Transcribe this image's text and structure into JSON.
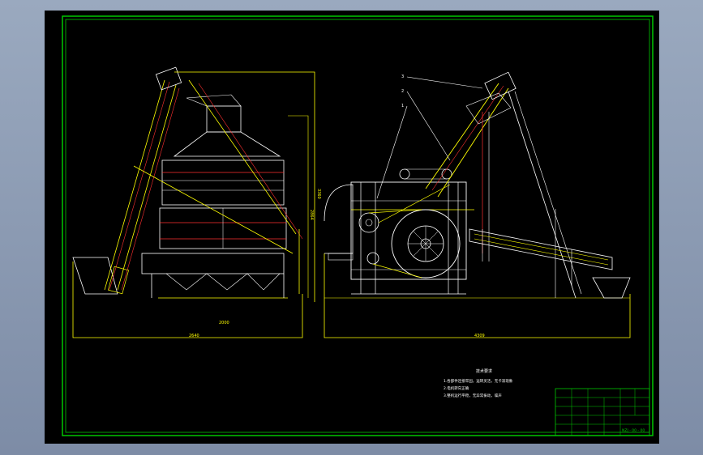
{
  "drawing": {
    "dimensions": {
      "left_width": "2640",
      "left_inner": "2000",
      "left_height_outer": "3360",
      "left_height_inner": "2864",
      "right_width": "4309"
    },
    "callouts": [
      "3",
      "2",
      "1"
    ],
    "notes": {
      "title": "技术要求",
      "line1": "1.各部件连接牢固，运转灵活，无卡滞现象",
      "line2": "2.电机转向正确",
      "line3": "3.整机运行平稳，无异常振动，噪声"
    },
    "title_block": {
      "drawing_no": "NZJ - 00 - 00"
    }
  },
  "colors": {
    "background": "#000000",
    "frame": "#00c800",
    "outline": "#ffff00",
    "machine": "#ffffff",
    "accent": "#ff3030",
    "dimension": "#ffff00"
  }
}
